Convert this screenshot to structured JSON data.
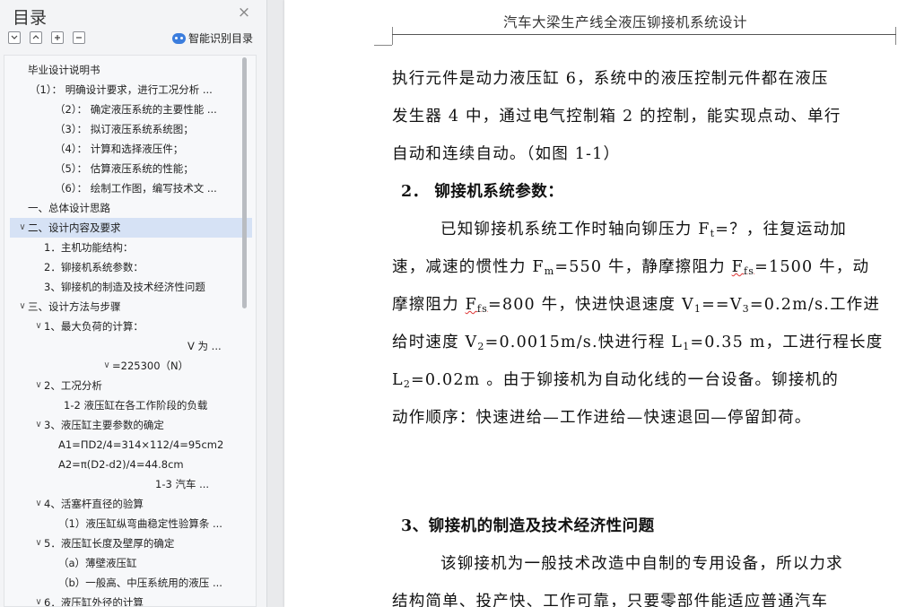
{
  "sidebar": {
    "title": "目录",
    "close_glyph": "×",
    "tools": [
      "collapse-all",
      "expand-level",
      "add-item",
      "remove-item"
    ],
    "smart_label": "智能识别目录",
    "items": [
      {
        "text": "毕业设计说明书",
        "indent": 28,
        "arrow": ""
      },
      {
        "text": "（1）：   明确设计要求，进行工况分析 ...",
        "indent": 30,
        "arrow": ""
      },
      {
        "text": "（2）：   确定液压系统的主要性能 ...",
        "indent": 58,
        "arrow": ""
      },
      {
        "text": "（3）：   拟订液压系统系统图；",
        "indent": 58,
        "arrow": ""
      },
      {
        "text": "（4）：   计算和选择液压件；",
        "indent": 58,
        "arrow": ""
      },
      {
        "text": "（5）：   估算液压系统的性能；",
        "indent": 58,
        "arrow": ""
      },
      {
        "text": "（6）：   绘制工作图，编写技术文 ...",
        "indent": 58,
        "arrow": ""
      },
      {
        "text": "一、总体设计思路",
        "indent": 28,
        "arrow": ""
      },
      {
        "text": "二、设计内容及要求",
        "indent": 28,
        "arrow": "v",
        "selected": true
      },
      {
        "text": "1．主机功能结构：",
        "indent": 46,
        "arrow": ""
      },
      {
        "text": "2．铆接机系统参数：",
        "indent": 46,
        "arrow": ""
      },
      {
        "text": "3、铆接机的制造及技术经济性问题",
        "indent": 46,
        "arrow": ""
      },
      {
        "text": "三、设计方法与步骤",
        "indent": 28,
        "arrow": "v"
      },
      {
        "text": "1、最大负荷的计算：",
        "indent": 46,
        "arrow": "v"
      },
      {
        "text": "V   为 ...",
        "indent": 206,
        "arrow": ""
      },
      {
        "text": "=225300（N）",
        "indent": 122,
        "arrow": "v"
      },
      {
        "text": "2、工况分析",
        "indent": 46,
        "arrow": "v"
      },
      {
        "text": "1-2 液压缸在各工作阶段的负载",
        "indent": 68,
        "arrow": ""
      },
      {
        "text": "3、液压缸主要参数的确定",
        "indent": 46,
        "arrow": "v"
      },
      {
        "text": "A1=ΠD2/4=314×112/4=95cm2",
        "indent": 62,
        "arrow": ""
      },
      {
        "text": "A2=π(D2-d2)/4=44.8cm",
        "indent": 62,
        "arrow": ""
      },
      {
        "text": "1-3      汽车 ...",
        "indent": 170,
        "arrow": ""
      },
      {
        "text": "4、活塞杆直径的验算",
        "indent": 46,
        "arrow": "v"
      },
      {
        "text": "（1）液压缸纵弯曲稳定性验算条 ...",
        "indent": 62,
        "arrow": ""
      },
      {
        "text": "5．液压缸长度及壁厚的确定",
        "indent": 46,
        "arrow": "v"
      },
      {
        "text": "（a）薄壁液压缸",
        "indent": 62,
        "arrow": ""
      },
      {
        "text": "（b）一般高、中压系统用的液压 ...",
        "indent": 62,
        "arrow": ""
      },
      {
        "text": "6．液压缸外径的计算",
        "indent": 46,
        "arrow": "v"
      }
    ]
  },
  "document": {
    "header": "汽车大梁生产线全液压铆接机系统设计",
    "lines": [
      {
        "type": "text",
        "text": "执行元件是动力液压缸 6，系统中的液压控制元件都在液压"
      },
      {
        "type": "text",
        "text": "发生器 4 中，通过电气控制箱 2 的控制，能实现点动、单行"
      },
      {
        "type": "text",
        "text": "自动和连续自动。（如图 1-1）"
      },
      {
        "type": "heading",
        "text": "2．  铆接机系统参数："
      },
      {
        "type": "indent",
        "parts": [
          "已知铆接机系统工作时轴向铆压力 F",
          "t",
          "=？，往复运动加"
        ]
      },
      {
        "type": "rich",
        "parts": [
          "速，减速的惯性力 F",
          "m",
          "=550 牛，静摩擦阻力 ",
          "F",
          "fs",
          "=1500 牛，动"
        ]
      },
      {
        "type": "rich",
        "parts": [
          "摩擦阻力 ",
          "F",
          "fs",
          "=800 牛，快进快退速度 V",
          "1",
          "==V",
          "3",
          "=0.2m/s.工作进"
        ]
      },
      {
        "type": "rich",
        "parts": [
          "给时速度 V",
          "2",
          "=0.0015m/s.快进行程 L",
          "1",
          "=0.35 m，工进行程长度"
        ]
      },
      {
        "type": "rich",
        "parts": [
          "L",
          "2",
          "=0.02m  。由于铆接机为自动化线的一台设备。铆接机的"
        ]
      },
      {
        "type": "text",
        "text": "动作顺序：快速进给—工作进给—快速退回—停留卸荷。"
      },
      {
        "type": "heading",
        "text": "3、铆接机的制造及技术经济性问题"
      },
      {
        "type": "indent",
        "text": "该铆接机为一般技术改造中自制的专用设备，所以力求"
      },
      {
        "type": "text",
        "text": "结构简单、投产快、工作可靠，只要零部件能适应普通汽车"
      }
    ]
  }
}
